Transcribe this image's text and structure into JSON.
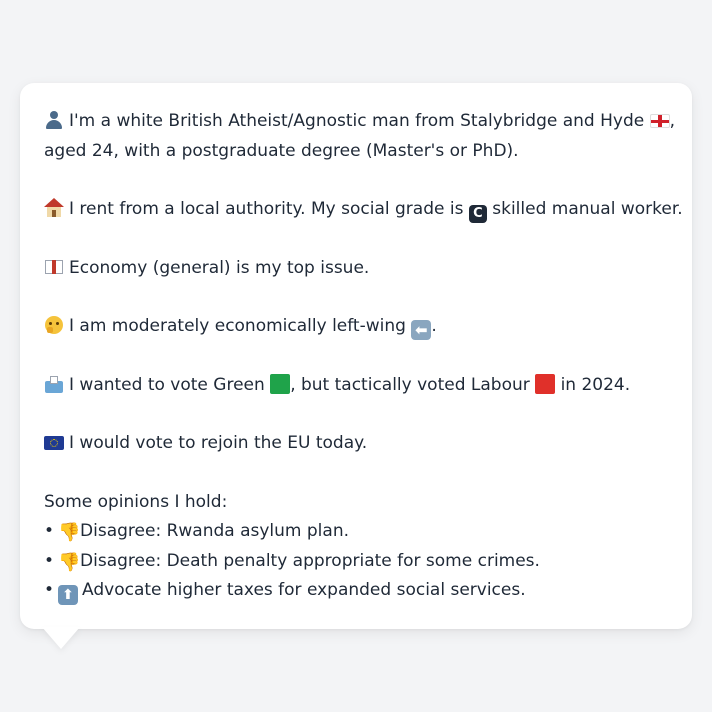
{
  "persona": {
    "identity_line1": "I'm a white British Atheist/Agnostic man from Stalybridge and Hyde",
    "identity_line1_tail": ",",
    "identity_line2": "aged 24, with a postgraduate degree (Master's or PhD).",
    "housing_text": "I rent from a local authority. My social grade is",
    "grade_letter": "C",
    "grade_text": "skilled manual worker.",
    "issue_text": "Economy (general) is my top issue.",
    "economic_text": "I am moderately economically left-wing",
    "economic_arrow": "⬅",
    "economic_tail": ".",
    "vote_text_a": "I wanted to vote Green",
    "vote_text_b": ", but tactically voted Labour",
    "vote_text_c": "in 2024.",
    "eu_text": "I would vote to rejoin the EU today.",
    "opinions_heading": "Some opinions I hold:",
    "opinions": [
      {
        "bullet": "•",
        "icon": "thumbs-down-icon",
        "text": "Disagree: Rwanda asylum plan."
      },
      {
        "bullet": "•",
        "icon": "thumbs-down-icon",
        "text": "Disagree: Death penalty appropriate for some crimes."
      },
      {
        "bullet": "•",
        "icon": "up-arrow-icon",
        "arrow": "⬆",
        "text": "Advocate higher taxes for expanded social services."
      }
    ]
  },
  "colors": {
    "background": "#f3f4f6",
    "card": "#ffffff",
    "text": "#1f2937",
    "green_party": "#1fa34a",
    "labour": "#e0302a"
  }
}
